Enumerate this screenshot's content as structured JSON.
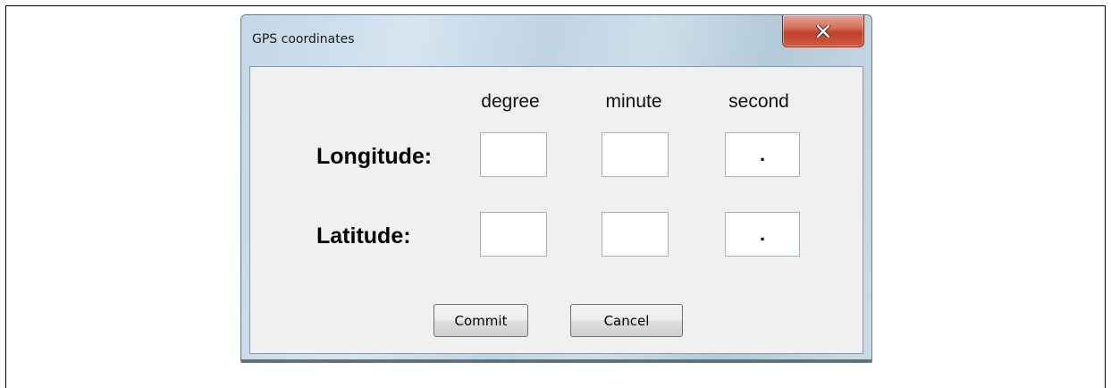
{
  "window": {
    "title": "GPS coordinates",
    "close_icon": "close-x-icon",
    "close_color": "#c2412a"
  },
  "columns": {
    "degree": "degree",
    "minute": "minute",
    "second": "second"
  },
  "rows": {
    "longitude": {
      "label": "Longitude:",
      "degree": "",
      "minute": "",
      "second": "."
    },
    "latitude": {
      "label": "Latitude:",
      "degree": "",
      "minute": "",
      "second": "."
    }
  },
  "buttons": {
    "commit": "Commit",
    "cancel": "Cancel"
  }
}
